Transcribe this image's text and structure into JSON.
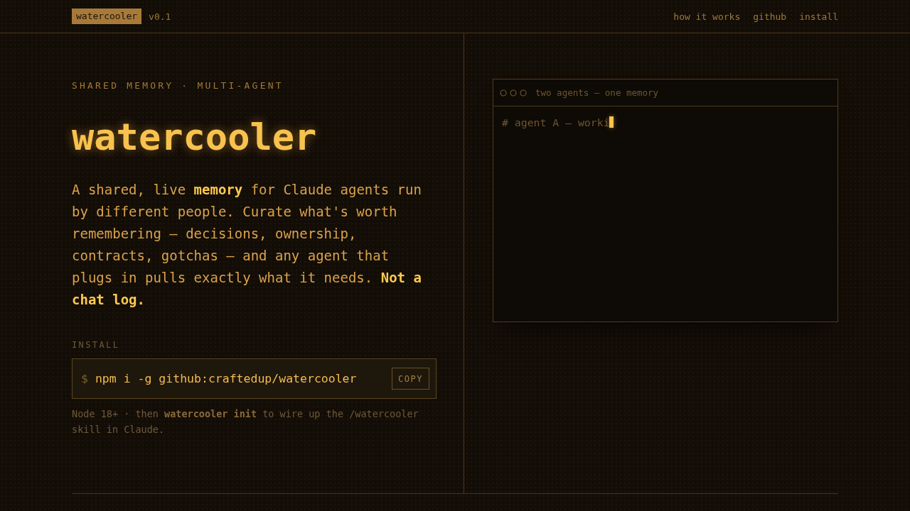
{
  "header": {
    "logo": "watercooler",
    "version": "v0.1",
    "nav": [
      "how it works",
      "github",
      "install"
    ]
  },
  "hero": {
    "eyebrow": "SHARED MEMORY · MULTI-AGENT",
    "title": "watercooler",
    "description": "A shared, live **memory** for Claude agents run by different people. Curate what's worth remembering — decisions, ownership, contracts, gotchas — and any agent that plugs in pulls exactly what it needs. **Not a chat log.**"
  },
  "install": {
    "label": "INSTALL",
    "prompt": "$",
    "command": "npm i -g github:craftedup/watercooler",
    "copy_button": "COPY",
    "note": "Node 18+ · then **watercooler init** to wire up the /watercooler skill in Claude."
  },
  "terminal": {
    "title": "two agents — one memory",
    "lines": [
      "# agent A — worki"
    ]
  }
}
